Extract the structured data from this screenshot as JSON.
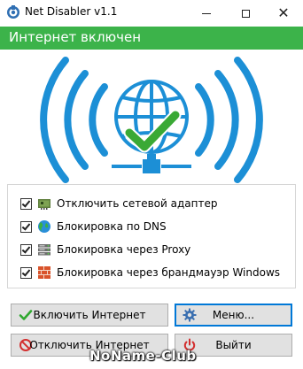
{
  "window": {
    "title": "Net Disabler v1.1"
  },
  "banner": {
    "status_text": "Интернет включен",
    "color": "#3cb34a"
  },
  "hero": {
    "icon": "globe-wifi-icon",
    "check_icon": "checkmark-icon",
    "accent": "#1c8fd6",
    "check_color": "#3aa935"
  },
  "options": [
    {
      "label": "Отключить сетевой адаптер",
      "checked": true,
      "icon": "network-adapter-icon"
    },
    {
      "label": "Блокировка по DNS",
      "checked": true,
      "icon": "globe-icon"
    },
    {
      "label": "Блокировка через Proxy",
      "checked": true,
      "icon": "server-icon"
    },
    {
      "label": "Блокировка через брандмауэр Windows",
      "checked": true,
      "icon": "firewall-icon"
    }
  ],
  "buttons": {
    "enable_label": "Включить Интернет",
    "menu_label": "Меню...",
    "disable_label": "Отключить Интернет",
    "exit_label": "Выйти"
  },
  "watermark": "NoName-Club"
}
